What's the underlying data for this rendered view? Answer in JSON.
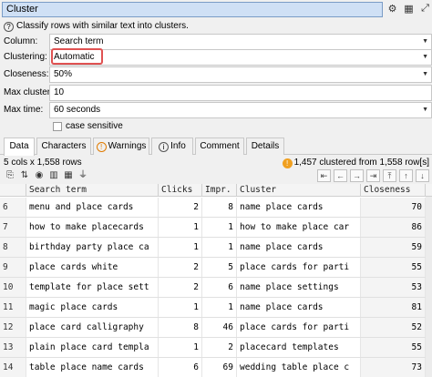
{
  "title": "Cluster",
  "help_text": "Classify rows with similar text into clusters.",
  "fields": {
    "column": {
      "label": "Column:",
      "value": "Search term"
    },
    "clustering": {
      "label": "Clustering:",
      "value": "Automatic"
    },
    "closeness": {
      "label": "Closeness:",
      "value": "50%"
    },
    "max_clusters": {
      "label": "Max clusters:",
      "value": "10"
    },
    "max_time": {
      "label": "Max time:",
      "value": "60 seconds"
    },
    "case_sensitive": {
      "label": "case sensitive",
      "checked": false
    }
  },
  "tabs": [
    {
      "label": "Data",
      "active": true
    },
    {
      "label": "Characters"
    },
    {
      "label": "Warnings"
    },
    {
      "label": "Info"
    },
    {
      "label": "Comment"
    },
    {
      "label": "Details"
    }
  ],
  "status": {
    "dims": "5 cols x 1,558 rows",
    "clustered": "1,457 clustered from 1,558 row[s]"
  },
  "table": {
    "columns": [
      "Search term",
      "Clicks",
      "Impr.",
      "Cluster",
      "Closeness"
    ],
    "rows": [
      {
        "idx": "6",
        "term": "menu and place cards",
        "clicks": "2",
        "impr": "8",
        "cluster": "name place cards",
        "closeness": "70"
      },
      {
        "idx": "7",
        "term": "how to make placecards",
        "clicks": "1",
        "impr": "1",
        "cluster": "how to make place car",
        "closeness": "86"
      },
      {
        "idx": "8",
        "term": "birthday party place ca",
        "clicks": "1",
        "impr": "1",
        "cluster": "name place cards",
        "closeness": "59"
      },
      {
        "idx": "9",
        "term": "place cards white",
        "clicks": "2",
        "impr": "5",
        "cluster": "place cards for parti",
        "closeness": "55"
      },
      {
        "idx": "10",
        "term": "template for place sett",
        "clicks": "2",
        "impr": "6",
        "cluster": "name place settings",
        "closeness": "53"
      },
      {
        "idx": "11",
        "term": "magic place cards",
        "clicks": "1",
        "impr": "1",
        "cluster": "name place cards",
        "closeness": "81"
      },
      {
        "idx": "12",
        "term": "place card calligraphy",
        "clicks": "8",
        "impr": "46",
        "cluster": "place cards for parti",
        "closeness": "52"
      },
      {
        "idx": "13",
        "term": "plain place card templa",
        "clicks": "1",
        "impr": "2",
        "cluster": "placecard templates",
        "closeness": "55"
      },
      {
        "idx": "14",
        "term": "table place name cards",
        "clicks": "6",
        "impr": "69",
        "cluster": "wedding table place c",
        "closeness": "73"
      }
    ]
  }
}
